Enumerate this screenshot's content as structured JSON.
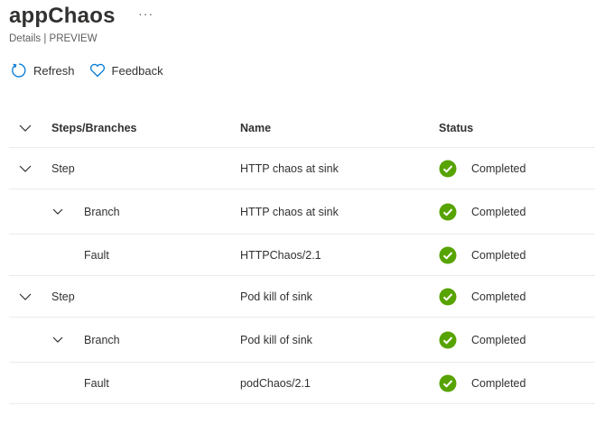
{
  "header": {
    "title": "appChaos",
    "more": "···",
    "subtitle": "Details | PREVIEW"
  },
  "toolbar": {
    "refresh_label": "Refresh",
    "feedback_label": "Feedback"
  },
  "table": {
    "columns": {
      "steps": "Steps/Branches",
      "name": "Name",
      "status": "Status"
    },
    "rows": [
      {
        "type": "Step",
        "name": "HTTP chaos at sink",
        "status": "Completed"
      },
      {
        "type": "Branch",
        "name": "HTTP chaos at sink",
        "status": "Completed"
      },
      {
        "type": "Fault",
        "name": "HTTPChaos/2.1",
        "status": "Completed"
      },
      {
        "type": "Step",
        "name": "Pod kill of sink",
        "status": "Completed"
      },
      {
        "type": "Branch",
        "name": "Pod kill of sink",
        "status": "Completed"
      },
      {
        "type": "Fault",
        "name": "podChaos/2.1",
        "status": "Completed"
      }
    ]
  },
  "colors": {
    "success": "#57a300",
    "accent": "#0078d4"
  },
  "icons": {
    "refresh": "refresh-icon",
    "feedback": "heart-icon",
    "expand": "chevron-down-icon",
    "status": "success-check-icon"
  }
}
